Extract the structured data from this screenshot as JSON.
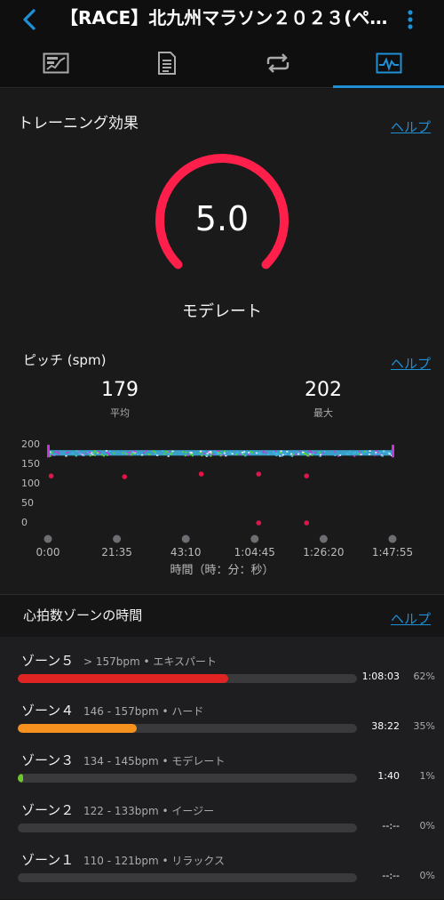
{
  "header": {
    "title": "【RACE】北九州マラソン２０２３(ペ…"
  },
  "tabs": [
    {
      "icon": "summary-chart-icon"
    },
    {
      "icon": "document-list-icon"
    },
    {
      "icon": "repeat-laps-icon"
    },
    {
      "icon": "activity-graph-icon",
      "active": true
    }
  ],
  "training_effect": {
    "title": "トレーニング効果",
    "help": "ヘルプ",
    "value": "5.0",
    "value_fraction": 1.0,
    "label": "モデレート",
    "color": "#ff1f4b"
  },
  "cadence": {
    "title": "ピッチ (spm)",
    "help": "ヘルプ",
    "avg_value": "179",
    "avg_label": "平均",
    "max_value": "202",
    "max_label": "最大",
    "x_axis_title": "時間（時：分：秒）"
  },
  "chart_data": {
    "type": "scatter",
    "title": "ピッチ (spm)",
    "xlabel": "時間（時：分：秒）",
    "ylabel": "",
    "y_ticks": [
      "200",
      "150",
      "100",
      "50",
      "0"
    ],
    "ylim": [
      0,
      200
    ],
    "x_ticks": [
      "0:00",
      "21:35",
      "43:10",
      "1:04:45",
      "1:26:20",
      "1:47:55"
    ],
    "xlim_seconds": [
      0,
      6475
    ],
    "grid": false,
    "band": {
      "y_min": 172,
      "y_max": 186,
      "colors": [
        "#3fb8e8",
        "#c23ad6",
        "#5ad62a",
        "#e8e8f0"
      ]
    },
    "outliers": [
      {
        "t": 60,
        "v": 120
      },
      {
        "t": 1440,
        "v": 118
      },
      {
        "t": 2880,
        "v": 125
      },
      {
        "t": 3960,
        "v": 125
      },
      {
        "t": 4860,
        "v": 120
      },
      {
        "t": 3960,
        "v": 0
      },
      {
        "t": 4860,
        "v": 0
      }
    ],
    "point_color": "#e0164a"
  },
  "hr_zones": {
    "title": "心拍数ゾーンの時間",
    "help": "ヘルプ",
    "zones": [
      {
        "name": "ゾーン５",
        "range": "> 157bpm • エキスパート",
        "time": "1:08:03",
        "percent": "62%",
        "fraction": 0.62,
        "color": "#e02424"
      },
      {
        "name": "ゾーン４",
        "range": "146 - 157bpm • ハード",
        "time": "38:22",
        "percent": "35%",
        "fraction": 0.35,
        "color": "#f5911e"
      },
      {
        "name": "ゾーン３",
        "range": "134 - 145bpm • モデレート",
        "time": "1:40",
        "percent": "1%",
        "fraction": 0.01,
        "color": "#6cc62e"
      },
      {
        "name": "ゾーン２",
        "range": "122 - 133bpm • イージー",
        "time": "--:--",
        "percent": "0%",
        "fraction": 0,
        "color": "#1f8fd6"
      },
      {
        "name": "ゾーン１",
        "range": "110 - 121bpm • リラックス",
        "time": "--:--",
        "percent": "0%",
        "fraction": 0,
        "color": "#9a9a9a"
      }
    ]
  }
}
